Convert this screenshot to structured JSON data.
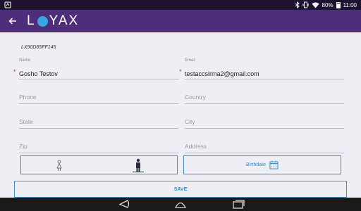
{
  "status_bar": {
    "battery": "80%",
    "time": "11:00",
    "icons": [
      "app-notification-icon",
      "bluetooth-icon",
      "vibrate-icon",
      "wifi-icon",
      "battery-icon"
    ]
  },
  "app_bar": {
    "back_icon": "arrow-left-icon",
    "logo_text_left": "L",
    "logo_text_right": "YAX",
    "accent_color": "#4e2e7a",
    "logo_dot_color": "#36a7e0"
  },
  "profile": {
    "user_id": "LX90D85FF145",
    "name": {
      "label": "Name",
      "value": "Gosho Testov",
      "required": "*"
    },
    "email": {
      "label": "Email",
      "value": "testaccsirma2@gmail.com",
      "required": "*"
    },
    "phone": {
      "placeholder": "Phone"
    },
    "country": {
      "placeholder": "Country"
    },
    "state": {
      "placeholder": "State"
    },
    "city": {
      "placeholder": "City"
    },
    "zip": {
      "placeholder": "Zip"
    },
    "address": {
      "placeholder": "Address"
    },
    "gender_options": [
      "female-icon",
      "male-icon"
    ],
    "birthdate_label": "Birthdate",
    "birthdate_icon": "calendar-icon",
    "save_label": "SAVE",
    "button_color": "#3a8fc4"
  },
  "nav_bar": {
    "icons": [
      "nav-back-icon",
      "nav-home-icon",
      "nav-recents-icon"
    ]
  }
}
